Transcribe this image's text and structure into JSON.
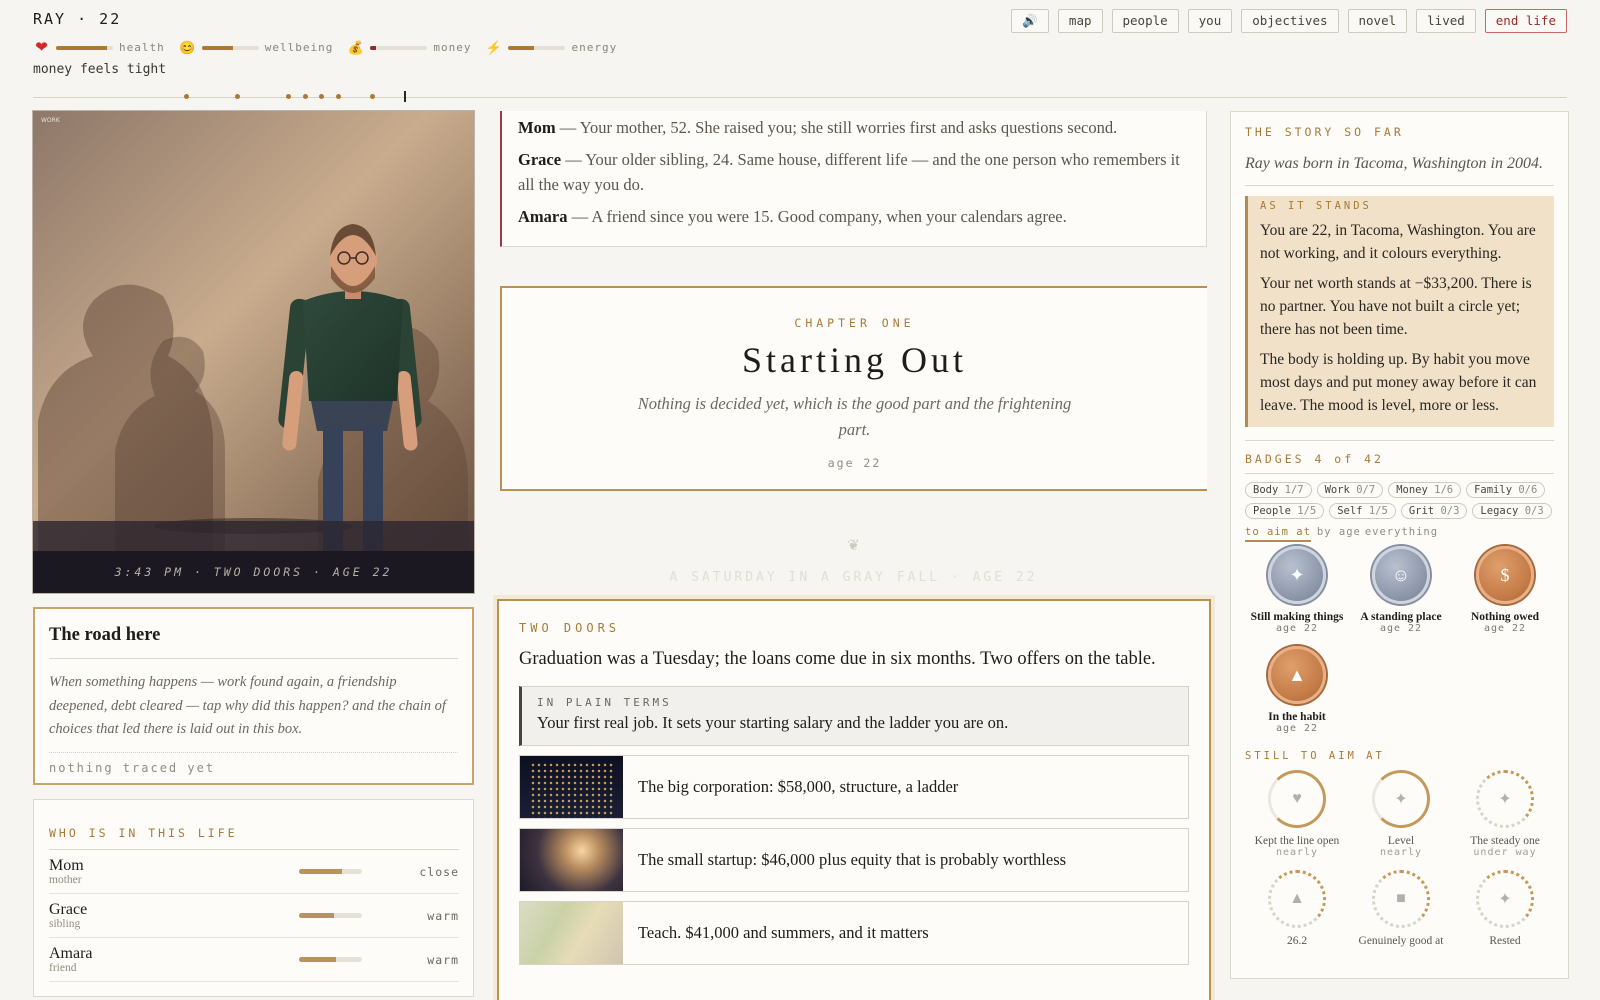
{
  "header": {
    "name_age": "RAY · 22",
    "mood": "money feels tight",
    "stats": [
      {
        "icon": "heart-icon",
        "glyph": "❤",
        "label": "health",
        "value": 0.9
      },
      {
        "icon": "smile-icon",
        "glyph": "😊",
        "label": "wellbeing",
        "value": 0.55
      },
      {
        "icon": "money-bag-icon",
        "glyph": "💰",
        "label": "money",
        "value": 0.1
      },
      {
        "icon": "lightning-icon",
        "glyph": "⚡",
        "label": "energy",
        "value": 0.45
      }
    ],
    "nav": [
      "🔊",
      "map",
      "people",
      "you",
      "objectives",
      "novel",
      "lived",
      "end life"
    ]
  },
  "scene": {
    "tag": "WORK",
    "caption": "3:43 PM · TWO DOORS · AGE 22"
  },
  "road": {
    "title": "The road here",
    "body": "When something happens — work found again, a friendship deepened, debt cleared — tap why did this happen? and the chain of choices that led there is laid out in this box.",
    "empty": "nothing traced yet"
  },
  "who": {
    "title": "WHO IS IN THIS LIFE",
    "people": [
      {
        "name": "Mom",
        "relation": "mother",
        "closeness": 0.68,
        "status": "close"
      },
      {
        "name": "Grace",
        "relation": "sibling",
        "closeness": 0.55,
        "status": "warm"
      },
      {
        "name": "Amara",
        "relation": "friend",
        "closeness": 0.58,
        "status": "warm"
      }
    ]
  },
  "family": [
    {
      "name": "Mom",
      "text": " — Your mother, 52. She raised you; she still worries first and asks questions second."
    },
    {
      "name": "Grace",
      "text": " — Your older sibling, 24. Same house, different life — and the one person who remembers it all the way you do."
    },
    {
      "name": "Amara",
      "text": " — A friend since you were 15. Good company, when your calendars agree."
    }
  ],
  "chapter": {
    "kicker": "CHAPTER ONE",
    "title": "Starting Out",
    "subtitle": "Nothing is decided yet, which is the good part and the frightening part.",
    "age": "age 22"
  },
  "divider": {
    "fleuron": "❦",
    "day": "A SATURDAY IN A GRAY FALL · AGE 22"
  },
  "event": {
    "kicker": "TWO DOORS",
    "lede": "Graduation was a Tuesday; the loans come due in six months. Two offers on the table.",
    "plain_label": "IN PLAIN TERMS",
    "plain_text": "Your first real job. It sets your starting salary and the ladder you are on.",
    "choices": [
      "The big corporation: $58,000, structure, a ladder",
      "The small startup: $46,000 plus equity that is probably worthless",
      "Teach. $41,000 and summers, and it matters"
    ]
  },
  "right": {
    "story_label": "THE STORY SO FAR",
    "story_line": "Ray was born in Tacoma, Washington in 2004.",
    "stands_label": "AS IT STANDS",
    "stands": [
      "You are 22, in Tacoma, Washington. You are not working, and it colours everything.",
      "Your net worth stands at −$33,200. There is no partner. You have not built a circle yet; there has not been time.",
      "The body is holding up. By habit you move most days and put money away before it can leave. The mood is level, more or less."
    ],
    "badges_label": "BADGES 4 of 42",
    "chips": [
      {
        "name": "Body",
        "count": "1/7"
      },
      {
        "name": "Work",
        "count": "0/7"
      },
      {
        "name": "Money",
        "count": "1/6"
      },
      {
        "name": "Family",
        "count": "0/6"
      },
      {
        "name": "People",
        "count": "1/5"
      },
      {
        "name": "Self",
        "count": "1/5"
      },
      {
        "name": "Grit",
        "count": "0/3"
      },
      {
        "name": "Legacy",
        "count": "0/3"
      }
    ],
    "aim_tabs": [
      "to aim at",
      "by age",
      "everything"
    ],
    "earned": [
      {
        "title": "Still making things",
        "age": "age 22",
        "glyph": "✦",
        "tier": "silver",
        "icon": "sparkle-icon"
      },
      {
        "title": "A standing place",
        "age": "age 22",
        "glyph": "☺",
        "tier": "silver",
        "icon": "smile-icon"
      },
      {
        "title": "Nothing owed",
        "age": "age 22",
        "glyph": "$",
        "tier": "bronze",
        "icon": "dollar-icon"
      },
      {
        "title": "In the habit",
        "age": "age 22",
        "glyph": "▲",
        "tier": "bronze",
        "icon": "triangle-icon"
      }
    ],
    "still_label": "STILL TO AIM AT",
    "pending": [
      {
        "title": "Kept the line open",
        "status": "nearly",
        "glyph": "♥",
        "ring": "part",
        "icon": "heart-outline-icon"
      },
      {
        "title": "Level",
        "status": "nearly",
        "glyph": "✦",
        "ring": "part",
        "icon": "sparkle-icon"
      },
      {
        "title": "The steady one",
        "status": "under way",
        "glyph": "✦",
        "ring": "dotted",
        "icon": "sparkle-icon"
      },
      {
        "title": "26.2",
        "status": "",
        "glyph": "▲",
        "ring": "dotted",
        "icon": "triangle-icon"
      },
      {
        "title": "Genuinely good at",
        "status": "",
        "glyph": "■",
        "ring": "dotted",
        "icon": "square-icon"
      },
      {
        "title": "Rested",
        "status": "",
        "glyph": "✦",
        "ring": "dotted",
        "icon": "sparkle-icon"
      }
    ]
  },
  "timeline": {
    "events": 7,
    "positions": [
      0.1,
      0.133,
      0.166,
      0.177,
      0.188,
      0.199,
      0.221
    ],
    "marker": 0.242
  }
}
